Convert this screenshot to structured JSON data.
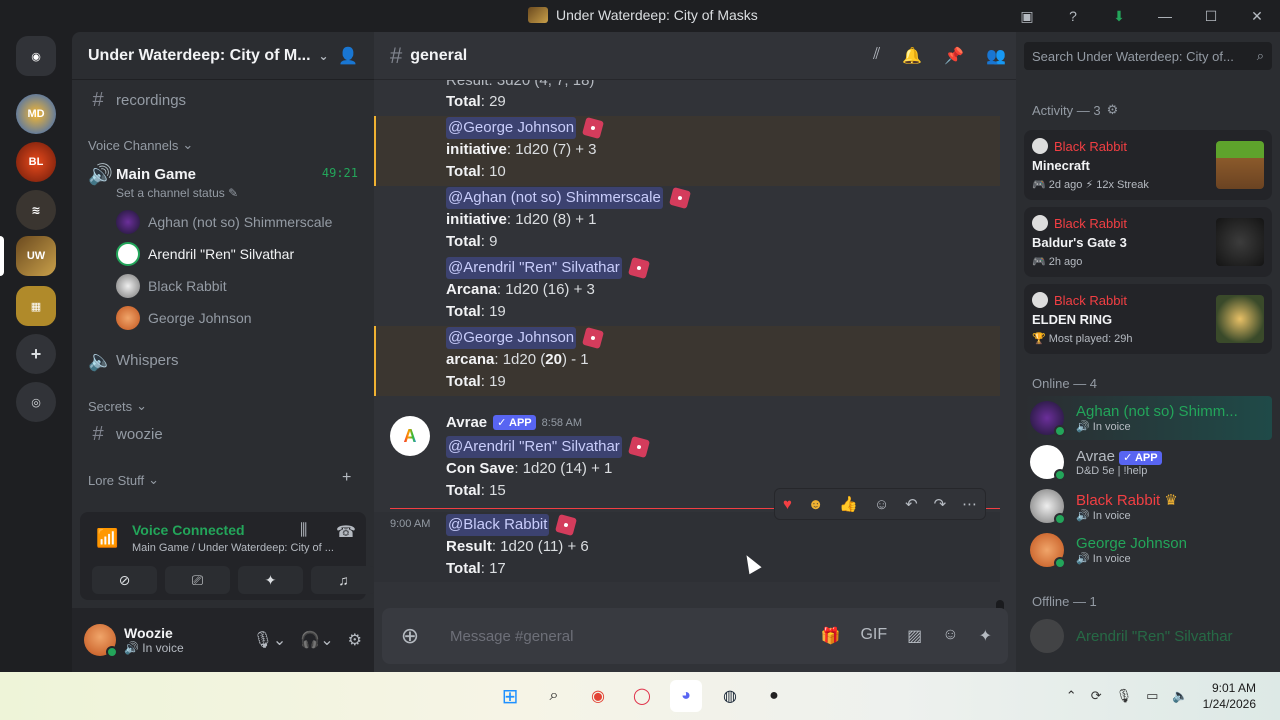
{
  "window": {
    "title": "Under Waterdeep: City of Masks"
  },
  "server": {
    "name": "Under Waterdeep: City of M..."
  },
  "sidebar": {
    "channels": [
      {
        "name": "recordings"
      },
      {
        "category": "Voice Channels"
      },
      {
        "name": "Main Game",
        "timer": "49:21",
        "status": "Set a channel status"
      },
      {
        "name": "Whispers"
      },
      {
        "category": "Secrets"
      },
      {
        "name": "woozie"
      },
      {
        "category": "Lore Stuff"
      }
    ],
    "voice_users": [
      "Aghan (not so) Shimmerscale",
      "Arendril \"Ren\" Silvathar",
      "Black Rabbit",
      "George Johnson"
    ]
  },
  "voice_panel": {
    "title": "Voice Connected",
    "sub": "Main Game / Under Waterdeep: City of ..."
  },
  "user": {
    "name": "Woozie",
    "status": "In voice"
  },
  "chat": {
    "channel": "general",
    "placeholder": "Message #general",
    "rolls": [
      {
        "label": "Total",
        "value": "29",
        "top_line": "Result: 3d20 (4, 7, 18)"
      },
      {
        "mention": "@George Johnson",
        "skill": "initiative",
        "expr": ": 1d20 (7) + 3",
        "total": "10"
      },
      {
        "mention": "@Aghan (not so) Shimmerscale",
        "skill": "initiative",
        "expr": ": 1d20 (8) + 1",
        "total": "9"
      },
      {
        "mention": "@Arendril \"Ren\" Silvathar",
        "skill": "Arcana",
        "expr": ": 1d20 (16) + 3",
        "total": "19"
      },
      {
        "mention": "@George Johnson",
        "skill": "arcana",
        "expr_pre": ": 1d20 (",
        "expr_bold": "20",
        "expr_post": ") - 1",
        "total": "19"
      },
      {
        "mention": "@Arendril \"Ren\" Silvathar",
        "skill": "Con Save",
        "expr": ": 1d20 (14) + 1",
        "total": "15"
      },
      {
        "mention": "@Black Rabbit",
        "skill": "Result",
        "expr": ": 1d20 (11) + 6",
        "total": "17"
      }
    ],
    "author": {
      "name": "Avrae",
      "badge": "APP",
      "time": "8:58 AM",
      "avatar": "A"
    },
    "last_time": "9:00 AM",
    "total_label": "Total"
  },
  "members": {
    "search_placeholder": "Search Under Waterdeep: City of...",
    "activity_header": "Activity — 3",
    "activities": [
      {
        "user": "Black Rabbit",
        "game": "Minecraft",
        "meta": "2d ago  ⚡ 12x Streak"
      },
      {
        "user": "Black Rabbit",
        "game": "Baldur's Gate 3",
        "meta": "2h ago"
      },
      {
        "user": "Black Rabbit",
        "game": "ELDEN RING",
        "meta": "Most played: 29h"
      }
    ],
    "online_header": "Online — 4",
    "online": [
      {
        "name": "Aghan (not so) Shimm...",
        "sub": "In voice",
        "color": "#23a55a"
      },
      {
        "name": "Avrae",
        "badge": "APP",
        "sub": "D&D 5e | !help",
        "color": "#b5bac1"
      },
      {
        "name": "Black Rabbit",
        "sub": "In voice",
        "color": "#f23f43"
      },
      {
        "name": "George Johnson",
        "sub": "In voice",
        "color": "#23a55a"
      }
    ],
    "offline_header": "Offline — 1",
    "offline": [
      {
        "name": "Arendril \"Ren\" Silvathar",
        "color": "#2a5a3a"
      }
    ]
  },
  "taskbar": {
    "time": "9:01 AM",
    "date": "1/24/2026"
  }
}
